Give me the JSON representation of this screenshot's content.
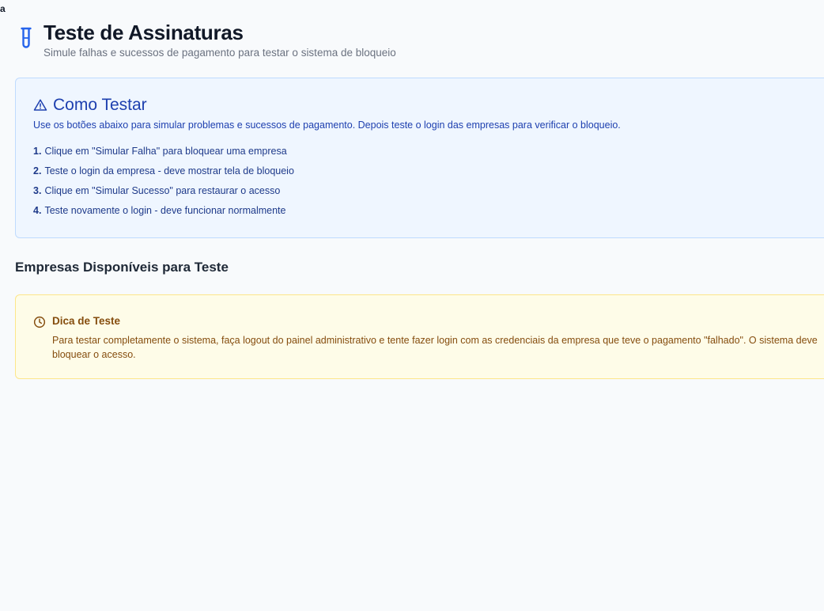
{
  "corner_text": "a",
  "header": {
    "icon": "test-tube-icon",
    "title": "Teste de Assinaturas",
    "subtitle": "Simule falhas e sucessos de pagamento para testar o sistema de bloqueio"
  },
  "info": {
    "icon": "warning-triangle-icon",
    "title": "Como Testar",
    "description": "Use os botões abaixo para simular problemas e sucessos de pagamento. Depois teste o login das empresas para verificar o bloqueio.",
    "steps": [
      {
        "num": "1.",
        "text": "Clique em \"Simular Falha\" para bloquear uma empresa"
      },
      {
        "num": "2.",
        "text": "Teste o login da empresa - deve mostrar tela de bloqueio"
      },
      {
        "num": "3.",
        "text": "Clique em \"Simular Sucesso\" para restaurar o acesso"
      },
      {
        "num": "4.",
        "text": "Teste novamente o login - deve funcionar normalmente"
      }
    ]
  },
  "companies_section": {
    "title": "Empresas Disponíveis para Teste"
  },
  "tip": {
    "icon": "clock-icon",
    "title": "Dica de Teste",
    "text": "Para testar completamente o sistema, faça logout do painel administrativo e tente fazer login com as credenciais da empresa que teve o pagamento \"falhado\". O sistema deve bloquear o acesso."
  },
  "colors": {
    "background": "#f8fafc",
    "info_bg": "#eff6ff",
    "info_border": "#bfdbfe",
    "info_text": "#1e40af",
    "tip_bg": "#fefce8",
    "tip_border": "#fde68a",
    "tip_text": "#854d0e",
    "icon_blue": "#2563eb"
  }
}
